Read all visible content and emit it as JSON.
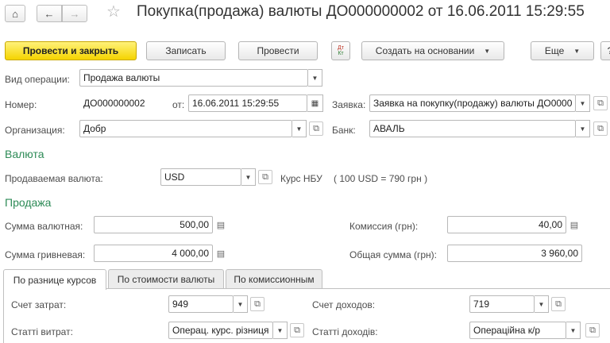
{
  "nav": {
    "home_icon": "home-icon",
    "back_icon": "arrow-left-icon",
    "forward_icon": "arrow-right-icon",
    "favorite_icon": "star-icon"
  },
  "window": {
    "title": "Покупка(продажа) валюты ДО000000002 от 16.06.2011 15:29:55"
  },
  "toolbar": {
    "post_close": "Провести и закрыть",
    "save": "Записать",
    "post": "Провести",
    "dt_kt_icon": "Дт Кт",
    "create_based": "Создать на основании",
    "more": "Еще",
    "help": "?"
  },
  "form": {
    "operation_label": "Вид операции:",
    "operation_value": "Продажа валюты",
    "number_label": "Номер:",
    "number_value": "ДО000000002",
    "date_label": "от:",
    "date_value": "16.06.2011 15:29:55",
    "request_label": "Заявка:",
    "request_value": "Заявка на покупку(продажу) валюты ДО0000",
    "org_label": "Организация:",
    "org_value": "Добр",
    "bank_label": "Банк:",
    "bank_value": "АВАЛЬ"
  },
  "currency_section": {
    "title": "Валюта",
    "sold_label": "Продаваемая валюта:",
    "sold_value": "USD",
    "rate_label": "Курс НБУ",
    "rate_value": "( 100 USD = 790 грн )"
  },
  "sale_section": {
    "title": "Продажа",
    "amount_cur_label": "Сумма валютная:",
    "amount_cur_value": "500,00",
    "commission_label": "Комиссия (грн):",
    "commission_value": "40,00",
    "amount_uah_label": "Сумма гривневая:",
    "amount_uah_value": "4 000,00",
    "total_label": "Общая сумма (грн):",
    "total_value": "3 960,00"
  },
  "tabs": [
    {
      "label": "По разнице курсов"
    },
    {
      "label": "По стоимости валюты"
    },
    {
      "label": "По комиссионным"
    }
  ],
  "tab_content": {
    "expense_acc_label": "Счет затрат:",
    "expense_acc_value": "949",
    "income_acc_label": "Счет доходов:",
    "income_acc_value": "719",
    "expense_item_label": "Статті витрат:",
    "expense_item_value": "Операц. курс. різниця",
    "income_item_label": "Статті доходів:",
    "income_item_value": "Операційна к/р"
  }
}
